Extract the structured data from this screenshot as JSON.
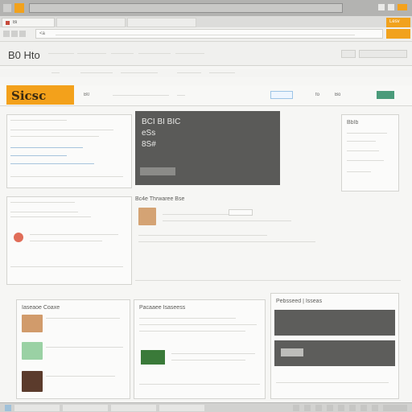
{
  "window": {
    "title_bar_bg": "#b9b9b7",
    "brand_color": "#f3a11b"
  },
  "browser": {
    "tab_label": "Bi",
    "tab_label_2": "Boh",
    "search_hint": "Lesv",
    "nav_label_1": "Bi",
    "nav_label_2": "Bu",
    "nav_label_3": "Boh",
    "address_prefix": "<a",
    "address_url": "",
    "right_tab_label": "Lesv",
    "right_cta_label": ""
  },
  "site_header": {
    "title": "B0 Hto",
    "menu": [
      "",
      "",
      "",
      "",
      ""
    ],
    "right_items": [
      "",
      ""
    ]
  },
  "site_nav": {
    "logo_text": "Sicsc",
    "tab_1": "B0",
    "tab_2": "",
    "right_1": "fo",
    "right_2": "Bo"
  },
  "left_panel_1": {
    "heading": "",
    "link_1": "",
    "link_2": "",
    "link_3": ""
  },
  "feature_panel": {
    "line_1": "BCI BI BIC",
    "line_2": "eSs",
    "line_3": "8S#",
    "button_label": ""
  },
  "right_widget": {
    "title": "BbIb"
  },
  "mid_section": {
    "title": "Bc4e Thrwaree Bse"
  },
  "bottom_left": {
    "heading": "Iaseaoe Coaxe"
  },
  "bottom_mid": {
    "heading": "Pacaaee Isaseess"
  },
  "bottom_right": {
    "heading": "Pebsseed | Isseas"
  },
  "footer": {
    "time": "",
    "taskbar_labels": [
      "",
      "",
      "",
      ""
    ]
  },
  "colors": {
    "accent": "#f3a11b",
    "link": "#2f6fa8",
    "dark_panel": "#5a5a58",
    "green": "#3a7a39"
  }
}
